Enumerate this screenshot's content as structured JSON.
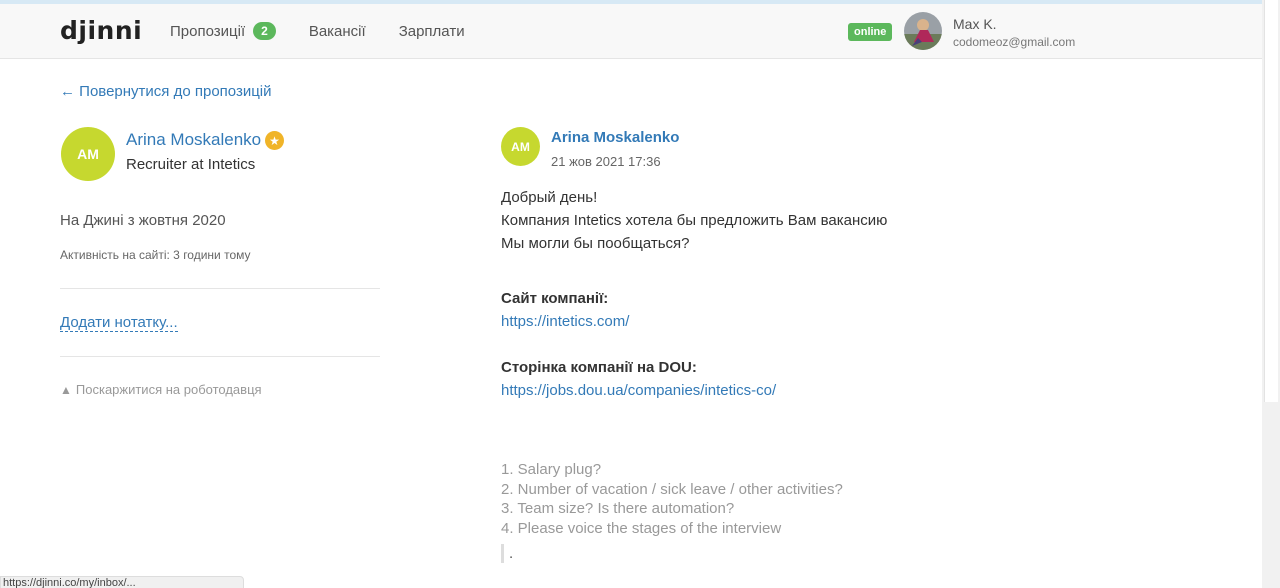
{
  "header": {
    "logo": "djinni",
    "nav": [
      {
        "label": "Пропозиції",
        "badge": "2"
      },
      {
        "label": "Вакансії"
      },
      {
        "label": "Зарплати"
      }
    ],
    "online_label": "online",
    "user_name": "Max K.",
    "user_email": "codomeoz@gmail.com"
  },
  "back_link": "← Повернутися до пропозицій",
  "recruiter": {
    "initials": "AM",
    "name": "Arina Moskalenko",
    "title": "Recruiter at Intetics",
    "joined": "На Джині з жовтня 2020",
    "activity": "Активність на сайті: 3 години тому",
    "add_note": "Додати нотатку...",
    "complain": "Поскаржитися на роботодавця"
  },
  "message": {
    "initials": "AM",
    "author": "Arina Moskalenko",
    "date": "21 жов 2021 17:36",
    "lines": [
      "Добрый день!",
      "Компания Intetics хотела бы предложить Вам вакансию",
      "Мы могли бы пообщаться?"
    ],
    "site_label": "Сайт компанії:",
    "site_url": "https://intetics.com/",
    "dou_label": "Сторінка компанії на DOU:",
    "dou_url": "https://jobs.dou.ua/companies/intetics-co/",
    "questions": [
      "1. Salary plug?",
      "2. Number of vacation / sick leave / other activities?",
      "3. Team size? Is there automation?",
      "4. Please voice the stages of the interview"
    ],
    "quote_text": "."
  },
  "status_bar_url": "https://djinni.co/my/inbox/...",
  "colors": {
    "accent_link": "#337ab7",
    "badge_green": "#5cb85c",
    "avatar_lime": "#c6d82f",
    "star_gold": "#f0b428"
  }
}
